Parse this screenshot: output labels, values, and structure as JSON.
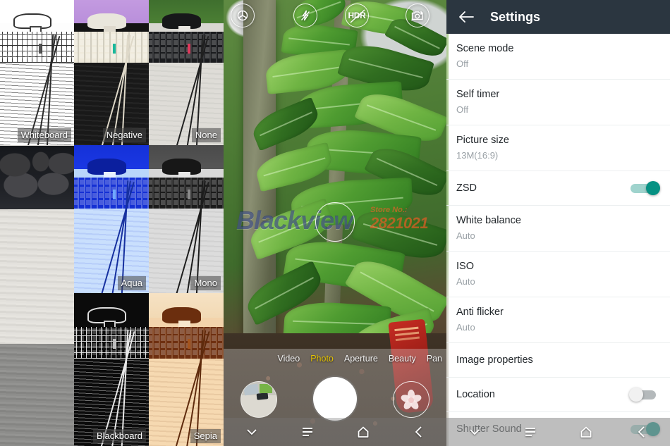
{
  "filter_panel": {
    "name": "color-effect-picker",
    "selected": "None",
    "filters": [
      {
        "label": "Whiteboard",
        "style": "f-whiteboard",
        "selected": false
      },
      {
        "label": "Negative",
        "style": "f-negative",
        "selected": false
      },
      {
        "label": "None",
        "style": "f-none",
        "selected": true
      },
      {
        "label": "",
        "style": "empty",
        "selected": false
      },
      {
        "label": "Aqua",
        "style": "f-aqua",
        "selected": false
      },
      {
        "label": "Mono",
        "style": "f-mono",
        "selected": false
      },
      {
        "label": "",
        "style": "empty",
        "selected": false
      },
      {
        "label": "Blackboard",
        "style": "f-blackboard",
        "selected": false
      },
      {
        "label": "Sepia",
        "style": "f-sepia",
        "selected": false
      }
    ]
  },
  "camera": {
    "top_icons": [
      {
        "name": "color-effect-icon",
        "label": ""
      },
      {
        "name": "flash-off-icon",
        "label": ""
      },
      {
        "name": "hdr-off-icon",
        "label": "HDR"
      },
      {
        "name": "switch-camera-icon",
        "label": ""
      }
    ],
    "hdr_label": "HDR",
    "watermark": {
      "brand": "Blackview",
      "store_label": "Store No.:",
      "store_number": "2821021"
    },
    "modes": [
      {
        "label": "Video",
        "active": false
      },
      {
        "label": "Photo",
        "active": true
      },
      {
        "label": "Aperture",
        "active": false
      },
      {
        "label": "Beauty",
        "active": false
      },
      {
        "label": "Pan",
        "active": false
      }
    ],
    "shutter_label": "Shutter",
    "gallery_label": "Gallery thumbnail",
    "beauty_label": "Beauty effect"
  },
  "settings": {
    "title": "Settings",
    "back_label": "Back",
    "rows": [
      {
        "label": "Scene mode",
        "value": "Off",
        "toggle": null
      },
      {
        "label": "Self timer",
        "value": "Off",
        "toggle": null
      },
      {
        "label": "Picture size",
        "value": "13M(16:9)",
        "toggle": null
      },
      {
        "label": "ZSD",
        "value": "",
        "toggle": "on"
      },
      {
        "label": "White balance",
        "value": "Auto",
        "toggle": null
      },
      {
        "label": "ISO",
        "value": "Auto",
        "toggle": null
      },
      {
        "label": "Anti flicker",
        "value": "Auto",
        "toggle": null
      },
      {
        "label": "Image properties",
        "value": "",
        "toggle": null
      },
      {
        "label": "Location",
        "value": "",
        "toggle": "off"
      },
      {
        "label": "Shutter Sound",
        "value": "",
        "toggle": "on"
      }
    ]
  },
  "navbar": {
    "items": [
      {
        "name": "collapse-icon",
        "label": "Hide"
      },
      {
        "name": "recents-icon",
        "label": "Recents"
      },
      {
        "name": "home-icon",
        "label": "Home"
      },
      {
        "name": "back-icon",
        "label": "Back"
      }
    ]
  },
  "colors": {
    "header": "#2b3640",
    "toggle_on": "#069183",
    "toggle_on_track": "#9fd3cd",
    "toggle_off": "#f1f1f1",
    "selection_border": "#4cb4d8",
    "active_mode": "#e6c400",
    "watermark_brand": "#2a3a78",
    "watermark_store": "#e45c24"
  }
}
